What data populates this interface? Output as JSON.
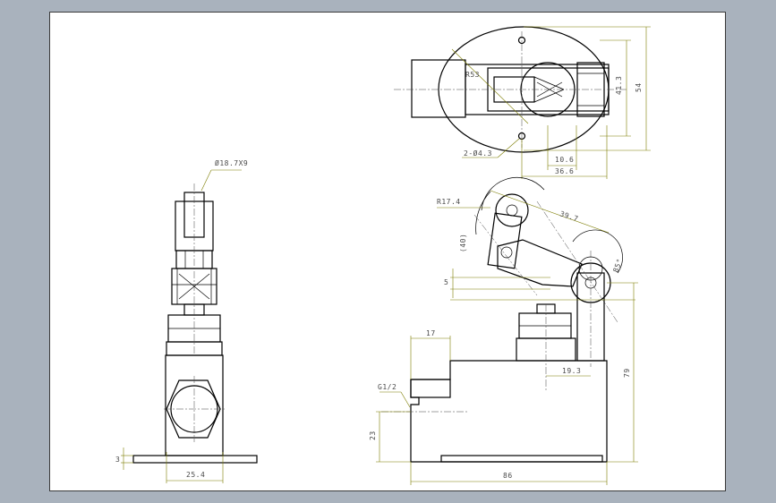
{
  "viewer": {
    "background": "#a9b2bd",
    "sheet_color": "#ffffff",
    "dimension_color": "#7c7c00"
  },
  "annotations": {
    "front_view": {
      "callout_dia": "Ø18.7X9",
      "dim_width": "25.4",
      "dim_base": "3"
    },
    "top_view": {
      "radius": "R53",
      "holes": "2-Ø4.3",
      "dim_height_inner": "41.3",
      "dim_height_outer": "54",
      "dim_width_inner": "10.6",
      "dim_width_outer": "36.6"
    },
    "side_view": {
      "roller_radius": "R17.4",
      "arm_length": "39.7",
      "arm_offset": "(40)",
      "angle": "85°",
      "step": "5",
      "boss_width": "17",
      "thread": "G1/2",
      "plunger_offset": "19.3",
      "body_height": "79",
      "thread_height": "23",
      "body_width": "86"
    }
  }
}
